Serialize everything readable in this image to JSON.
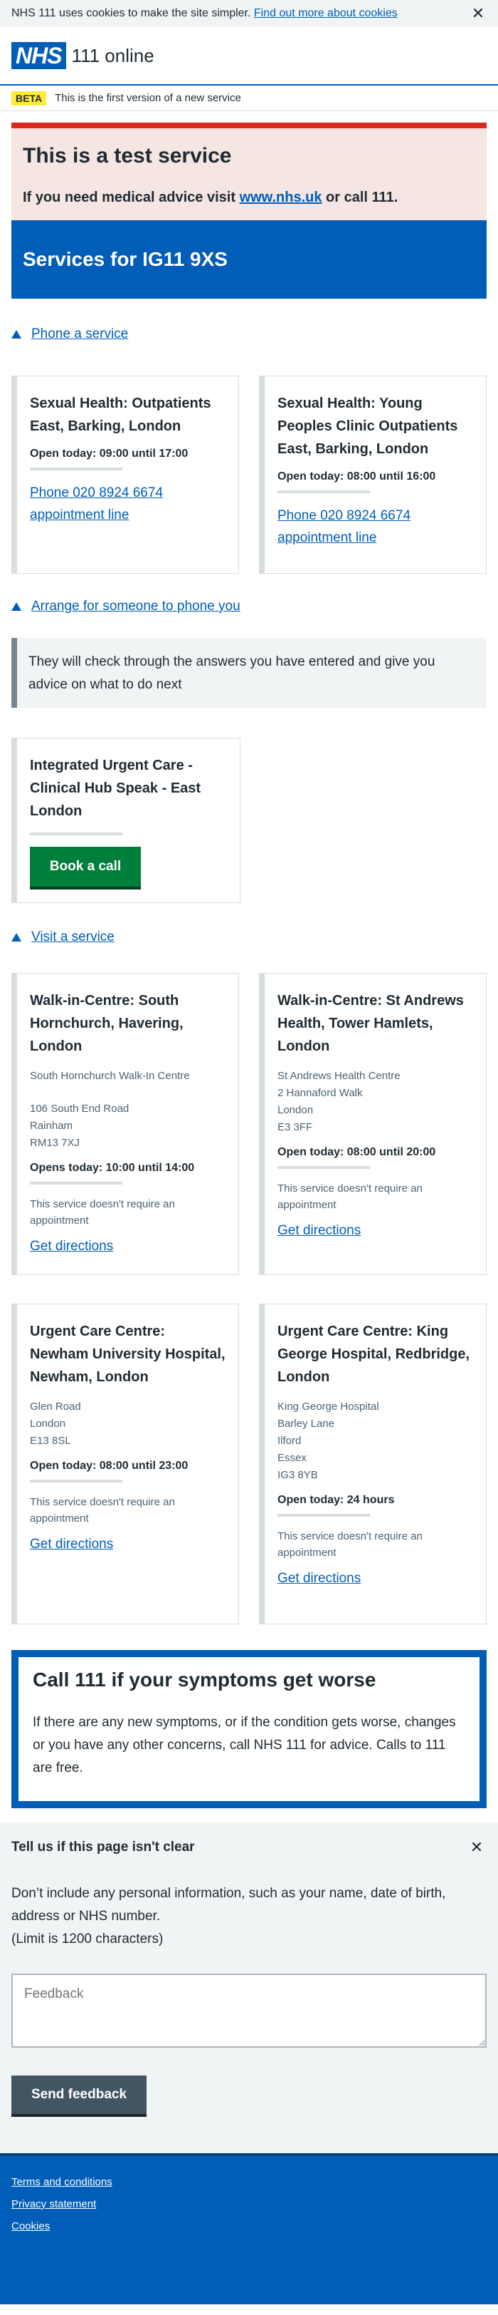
{
  "cookie_banner": {
    "text": "NHS 111 uses cookies to make the site simpler. ",
    "link": "Find out more about cookies",
    "close_glyph": "✕"
  },
  "header": {
    "logo": "NHS",
    "service": "111 online"
  },
  "beta": {
    "tag": "BETA",
    "text": "This is the first version of a new service"
  },
  "warning": {
    "title": "This is a test service",
    "text_before": "If you need medical advice visit ",
    "link": "www.nhs.uk",
    "text_after": " or call 111."
  },
  "services": {
    "heading": "Services for IG11 9XS"
  },
  "phone_section": {
    "toggle": "Phone a service",
    "cards": [
      {
        "title": "Sexual Health: Outpatients East, Barking, London",
        "open": "Open today: 09:00 until 17:00",
        "phone": "Phone 020 8924 6674 appointment line"
      },
      {
        "title": "Sexual Health: Young Peoples Clinic Outpatients East, Barking, London",
        "open": "Open today: 08:00 until 16:00",
        "phone": "Phone 020 8924 6674 appointment line"
      }
    ]
  },
  "callback_section": {
    "toggle": "Arrange for someone to phone you",
    "inset": "They will check through the answers you have entered and give you advice on what to do next",
    "card": {
      "title": "Integrated Urgent Care - Clinical Hub Speak - East London",
      "button": "Book a call"
    }
  },
  "visit_section": {
    "toggle": "Visit a service",
    "cards": [
      {
        "title": "Walk-in-Centre: South Hornchurch, Havering, London",
        "org": "South Hornchurch Walk-In Centre",
        "address": [
          "106 South End Road",
          "Rainham",
          "RM13 7XJ"
        ],
        "open": "Opens today: 10:00 until 14:00",
        "note": "This service doesn't require an appointment",
        "directions": "Get directions"
      },
      {
        "title": "Walk-in-Centre: St Andrews Health, Tower Hamlets, London",
        "org": "",
        "address": [
          "St Andrews Health Centre",
          "2 Hannaford Walk",
          "London",
          "E3 3FF"
        ],
        "open": "Open today: 08:00 until 20:00",
        "note": "This service doesn't require an appointment",
        "directions": "Get directions"
      },
      {
        "title": "Urgent Care Centre: Newham University Hospital, Newham, London",
        "org": "",
        "address": [
          "Glen Road",
          "London",
          "E13 8SL"
        ],
        "open": "Open today: 08:00 until 23:00",
        "note": "This service doesn't require an appointment",
        "directions": "Get directions"
      },
      {
        "title": "Urgent Care Centre: King George Hospital, Redbridge, London",
        "org": "",
        "address": [
          "King George Hospital",
          "Barley Lane",
          "Ilford",
          "Essex",
          "IG3 8YB"
        ],
        "open": "Open today: 24 hours",
        "note": "This service doesn't require an appointment",
        "directions": "Get directions"
      }
    ]
  },
  "care_card": {
    "title": "Call 111 if your symptoms get worse",
    "text": "If there are any new symptoms, or if the condition gets worse, changes or you have any other concerns, call NHS 111 for advice. Calls to 111 are free."
  },
  "feedback": {
    "title": "Tell us if this page isn't clear",
    "close_glyph": "✕",
    "text": "Don’t include any personal information, such as your name, date of birth, address or NHS number.",
    "limit": "(Limit is 1200 characters)",
    "placeholder": "Feedback",
    "button": "Send feedback"
  },
  "footer": {
    "links": [
      "Terms and conditions",
      "Privacy statement",
      "Cookies"
    ]
  },
  "colors": {
    "nhs_blue": "#005eb8",
    "warning_red": "#da291c",
    "button_green": "#007f3b",
    "feedback_button": "#425563"
  }
}
